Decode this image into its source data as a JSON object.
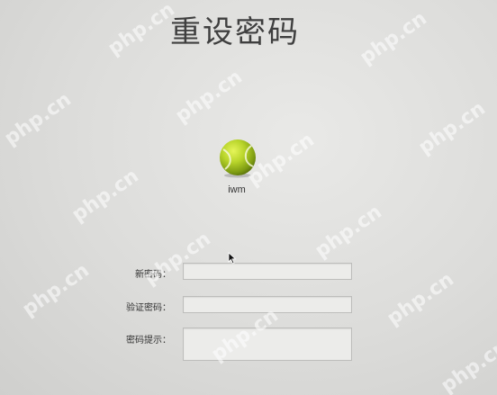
{
  "window": {
    "title": "重设密码"
  },
  "user": {
    "avatar_icon": "tennis-ball-icon",
    "name": "iwm",
    "avatar_color": "#b4d422"
  },
  "form": {
    "new_password": {
      "label": "新密码：",
      "value": ""
    },
    "verify_password": {
      "label": "验证密码：",
      "value": ""
    },
    "password_hint": {
      "label": "密码提示：",
      "value": ""
    }
  },
  "watermark": {
    "text": "php.cn"
  },
  "colors": {
    "background": "#dcdcda",
    "title": "#3f3f3f",
    "field_background": "#ececea",
    "field_border": "#bdbdbb"
  }
}
